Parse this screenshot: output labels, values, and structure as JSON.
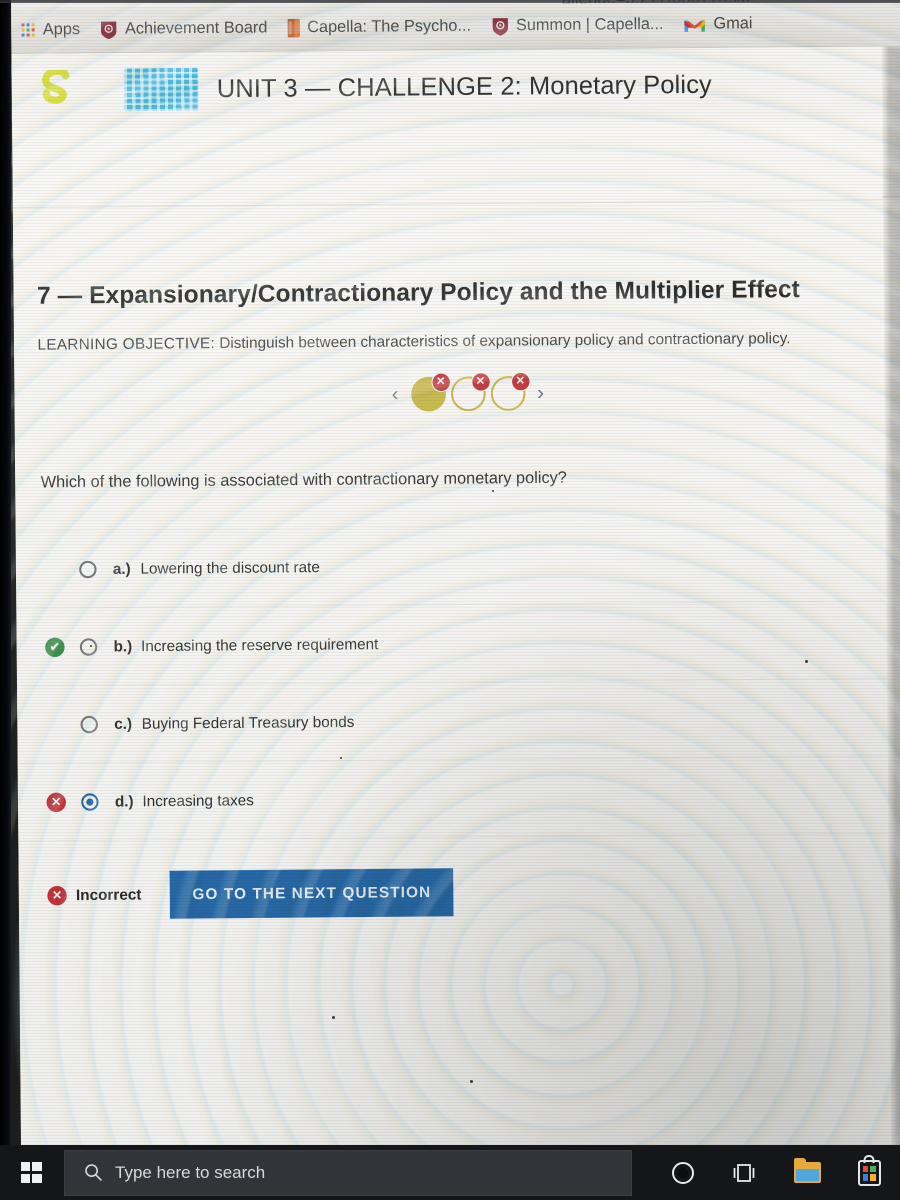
{
  "browser": {
    "url_fragment": "allenge=5:277/85677/exp",
    "bookmarks": [
      {
        "label": "Apps",
        "icon": "apps-grid-icon"
      },
      {
        "label": "Achievement Board",
        "icon": "shield-icon"
      },
      {
        "label": "Capella: The Psycho...",
        "icon": "book-icon"
      },
      {
        "label": "Summon | Capella...",
        "icon": "shield-icon"
      },
      {
        "label": "Gmai",
        "icon": "gmail-icon"
      }
    ]
  },
  "course_header": {
    "logo": "sophia-s-logo",
    "unit_icon": "unit-grid-icon",
    "title": "UNIT 3 — CHALLENGE 2: Monetary Policy"
  },
  "lesson": {
    "number_and_title": "7 — Expansionary/Contractionary Policy and the Multiplier Effect",
    "objective_label": "LEARNING OBJECTIVE:",
    "objective_text": "Distinguish between characteristics of expansionary policy and contractionary policy."
  },
  "stepnav": {
    "prev_icon": "chevron-left-icon",
    "next_icon": "chevron-right-icon",
    "prev_glyph": "‹",
    "next_glyph": "›",
    "steps": [
      {
        "state": "current",
        "badge": "✕",
        "badge_name": "wrong-badge"
      },
      {
        "state": "empty",
        "badge": "✕",
        "badge_name": "wrong-badge"
      },
      {
        "state": "empty",
        "badge": "✕",
        "badge_name": "wrong-badge"
      }
    ]
  },
  "question": {
    "prompt": "Which of the following is associated with contractionary monetary policy?",
    "options": [
      {
        "letter": "a.)",
        "text": "Lowering the discount rate",
        "mark": "none",
        "mark_glyph": "",
        "selected": false
      },
      {
        "letter": "b.)",
        "text": "Increasing the reserve requirement",
        "mark": "correct",
        "mark_glyph": "✔",
        "selected": false
      },
      {
        "letter": "c.)",
        "text": "Buying Federal Treasury bonds",
        "mark": "none",
        "mark_glyph": "",
        "selected": false
      },
      {
        "letter": "d.)",
        "text": "Increasing taxes",
        "mark": "wrong",
        "mark_glyph": "✕",
        "selected": true
      }
    ]
  },
  "result": {
    "badge_glyph": "✕",
    "label": "Incorrect",
    "next_button": "GO TO THE NEXT QUESTION"
  },
  "taskbar": {
    "start_icon": "windows-start-icon",
    "search_placeholder": "Type here to search",
    "search_icon": "search-icon",
    "items": [
      {
        "name": "cortana-icon"
      },
      {
        "name": "task-view-icon"
      },
      {
        "name": "file-explorer-icon"
      },
      {
        "name": "microsoft-store-icon"
      }
    ]
  },
  "colors": {
    "accent_blue": "#1a62a6",
    "correct_green": "#2e8b3d",
    "wrong_red": "#c4282c",
    "unit_icon_blue": "#30b3dd",
    "step_yellow": "#c8b73c",
    "page_bg": "#fbfaf7"
  }
}
